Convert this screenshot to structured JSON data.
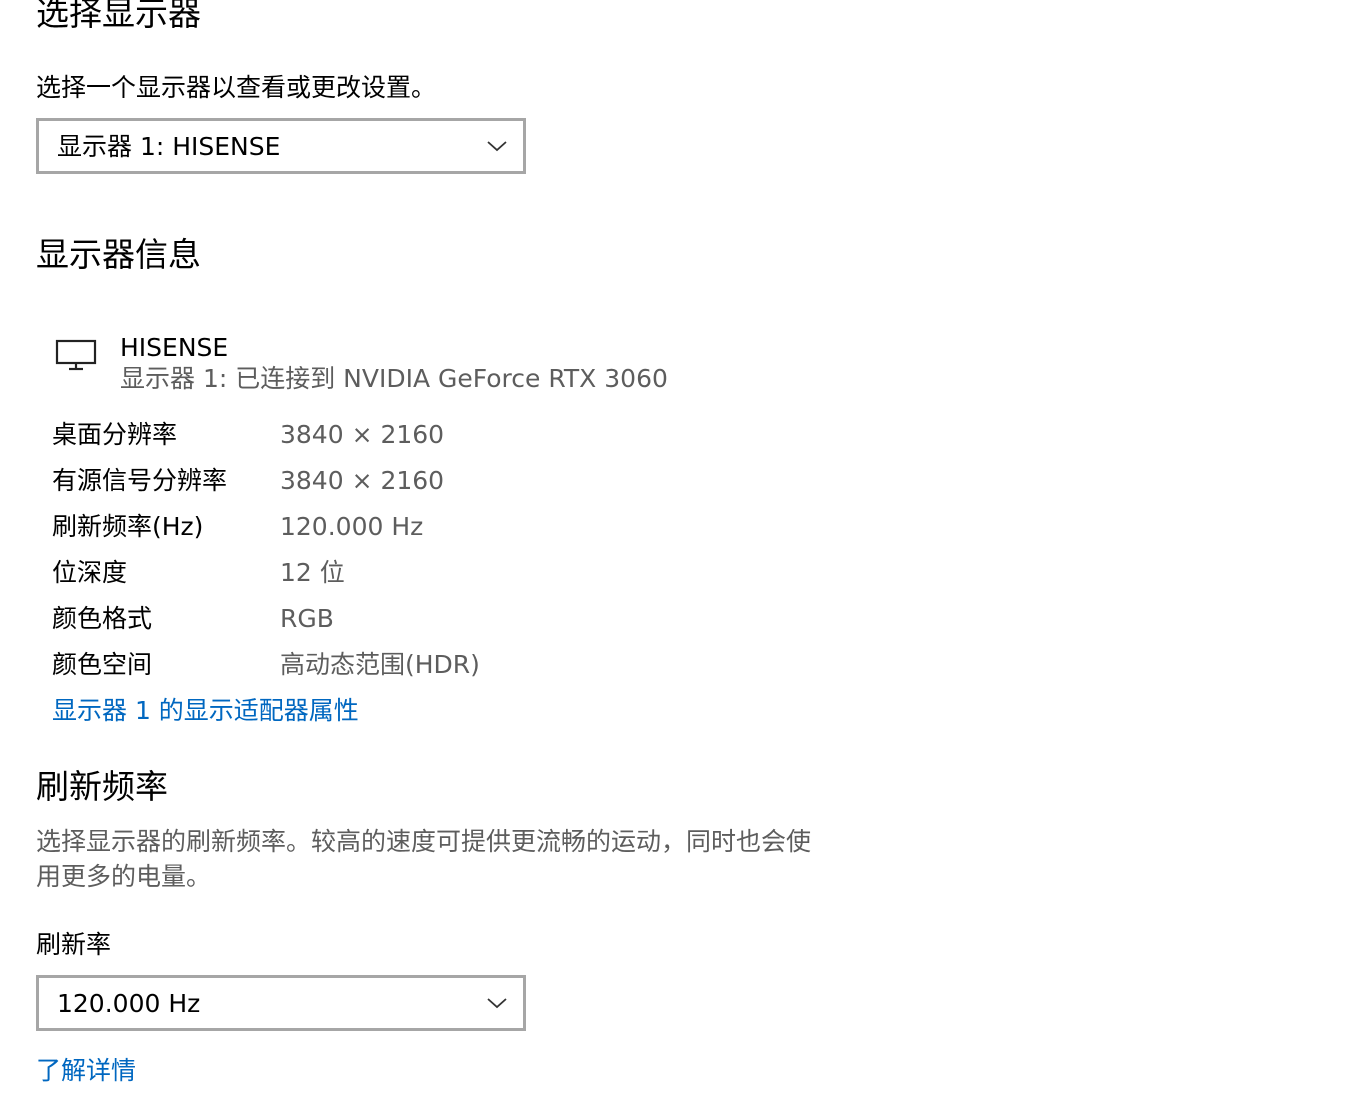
{
  "select_display": {
    "heading": "选择显示器",
    "prompt": "选择一个显示器以查看或更改设置。",
    "selected": "显示器 1: HISENSE"
  },
  "display_info": {
    "heading": "显示器信息",
    "monitor_icon": "monitor-icon",
    "name": "HISENSE",
    "connection": "显示器 1: 已连接到 NVIDIA GeForce RTX 3060",
    "rows": [
      {
        "label": "桌面分辨率",
        "value": "3840 × 2160"
      },
      {
        "label": "有源信号分辨率",
        "value": "3840 × 2160"
      },
      {
        "label": "刷新频率(Hz)",
        "value": "120.000 Hz"
      },
      {
        "label": "位深度",
        "value": "12 位"
      },
      {
        "label": "颜色格式",
        "value": "RGB"
      },
      {
        "label": "颜色空间",
        "value": "高动态范围(HDR)"
      }
    ],
    "adapter_link": "显示器 1 的显示适配器属性"
  },
  "refresh_rate": {
    "heading": "刷新频率",
    "description": "选择显示器的刷新频率。较高的速度可提供更流畅的运动，同时也会使用更多的电量。",
    "field_label": "刷新率",
    "selected": "120.000 Hz",
    "learn_more": "了解详情"
  },
  "colors": {
    "link": "#0067c0",
    "secondary_text": "#5d5d5d",
    "dropdown_border": "#a6a6a6"
  }
}
